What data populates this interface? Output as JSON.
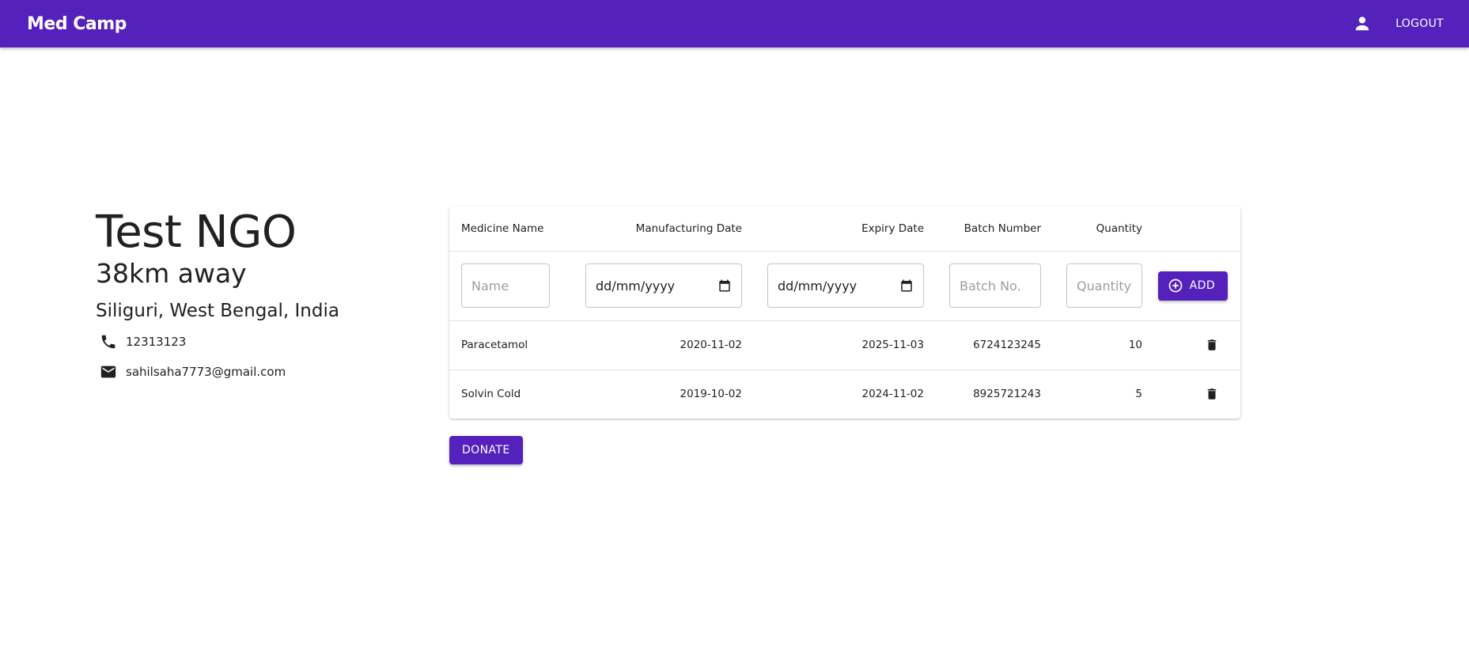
{
  "appbar": {
    "brand": "Med Camp",
    "user_icon": "person-icon",
    "logout_label": "LOGOUT",
    "background_color": "#5521bd"
  },
  "ngo": {
    "name": "Test NGO",
    "distance": "38km away",
    "location": "Siliguri, West Bengal, India",
    "phone": "12313123",
    "phone_icon": "phone-icon",
    "email": "sahilsaha7773@gmail.com",
    "email_icon": "mail-icon"
  },
  "table": {
    "headers": {
      "name": "Medicine Name",
      "mfg": "Manufacturing Date",
      "exp": "Expiry Date",
      "batch": "Batch Number",
      "qty": "Quantity"
    },
    "inputs": {
      "name_placeholder": "Name",
      "mfg_value": "dd/mm/yyyy",
      "exp_value": "dd/mm/yyyy",
      "batch_placeholder": "Batch No.",
      "qty_placeholder": "Quantity",
      "add_label": "ADD"
    },
    "rows": [
      {
        "name": "Paracetamol",
        "mfg": "2020-11-02",
        "exp": "2025-11-03",
        "batch": "6724123245",
        "qty": "10"
      },
      {
        "name": "Solvin Cold",
        "mfg": "2019-10-02",
        "exp": "2024-11-02",
        "batch": "8925721243",
        "qty": "5"
      }
    ]
  },
  "donate_label": "DONATE"
}
